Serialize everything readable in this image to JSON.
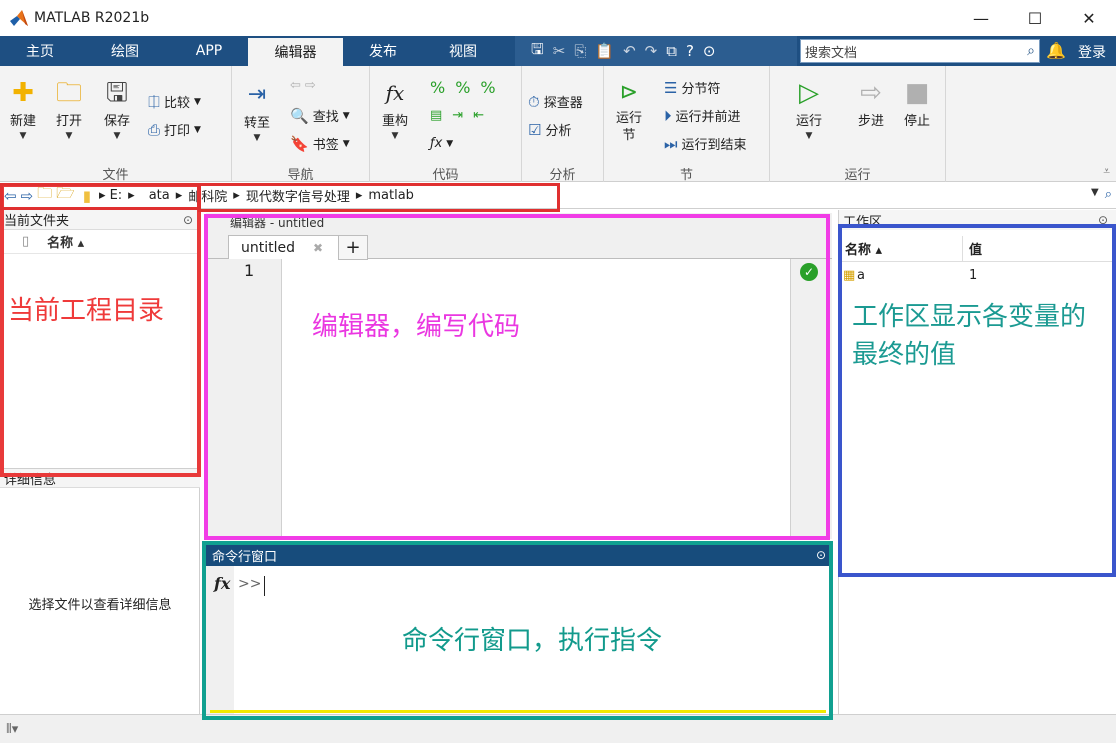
{
  "window": {
    "title": "MATLAB R2021b",
    "minimize": "—",
    "maximize": "☐",
    "close": "✕"
  },
  "tabs": [
    {
      "label": "主页"
    },
    {
      "label": "绘图"
    },
    {
      "label": "APP"
    },
    {
      "label": "编辑器",
      "active": true
    },
    {
      "label": "发布"
    },
    {
      "label": "视图"
    }
  ],
  "search": {
    "placeholder": "搜索文档"
  },
  "login_label": "登录",
  "ribbon": {
    "file": {
      "label": "文件",
      "new": "新建",
      "open": "打开",
      "save": "保存",
      "compare": "比较",
      "print": "打印"
    },
    "navigate": {
      "label": "导航",
      "goto": "转至",
      "find": "查找",
      "bookmark": "书签"
    },
    "code": {
      "label": "代码",
      "refactor": "重构"
    },
    "analyze": {
      "label": "分析",
      "inspector": "探查器",
      "analyze": "分析"
    },
    "section": {
      "label": "节",
      "run_section_1": "运行",
      "run_section_2": "节",
      "section_break": "分节符",
      "run_advance": "运行并前进",
      "run_to_end": "运行到结束"
    },
    "run": {
      "label": "运行",
      "run": "运行",
      "step": "步进",
      "stop": "停止"
    }
  },
  "address": {
    "drive": "E:",
    "segments": [
      "ata",
      "邮科院",
      "现代数字信号处理",
      "matlab"
    ]
  },
  "current_folder": {
    "title": "当前文件夹",
    "col_name": "名称 ▴",
    "details_title": "详细信息",
    "details_message": "选择文件以查看详细信息"
  },
  "editor": {
    "header": "编辑器 - untitled",
    "tab_label": "untitled",
    "line_number": "1"
  },
  "command_window": {
    "title": "命令行窗口",
    "fx": "fx",
    "prompt": ">>"
  },
  "workspace": {
    "title": "工作区",
    "col_name": "名称 ▴",
    "col_value": "值",
    "rows": [
      {
        "name": "a",
        "value": "1"
      }
    ]
  },
  "annotations": {
    "folder": "当前工程目录",
    "editor": "编辑器，编写代码",
    "workspace": "工作区显示各变量的最终的值",
    "command": "命令行窗口，执行指令"
  },
  "colors": {
    "tab_bar": "#1e4f82",
    "red_box": "#e83a3a",
    "magenta_box": "#f13ce6",
    "teal_box": "#10a090",
    "blue_box": "#3a55cc"
  }
}
